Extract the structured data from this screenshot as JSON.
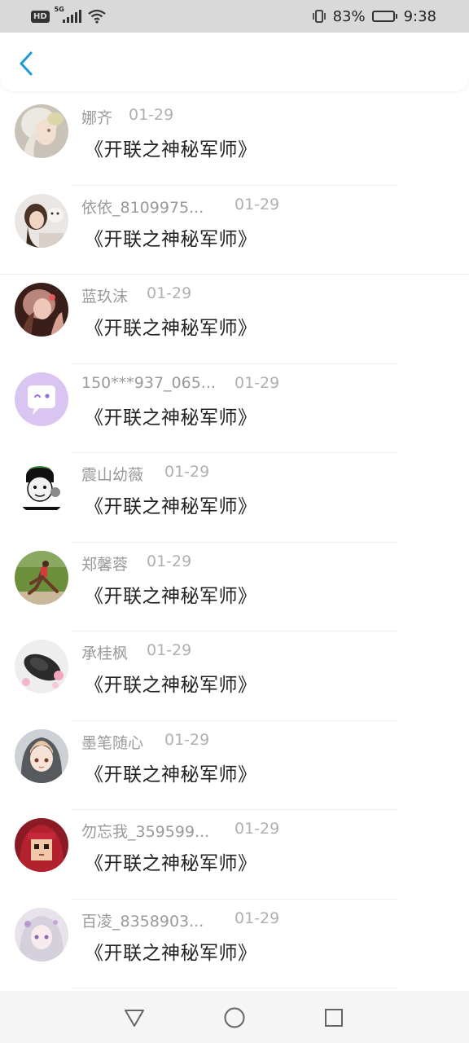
{
  "status_bar": {
    "hd": "HD",
    "network": "5G",
    "battery_percent": "83%",
    "battery_level": 0.83,
    "time": "9:38"
  },
  "header": {
    "back_icon": "chevron-left-icon",
    "accent": "#1a9ad6"
  },
  "items": [
    {
      "name": "娜齐",
      "date": "01-29",
      "title": "《开联之神秘军师》",
      "avatar": "anime-girl-white-hair"
    },
    {
      "name": "依依_8109975...",
      "date": "01-29",
      "title": "《开联之神秘军师》",
      "avatar": "girl-with-dog"
    },
    {
      "name": "蓝玖沫",
      "date": "01-29",
      "title": "《开联之神秘军师》",
      "avatar": "girl-photo"
    },
    {
      "name": "150***937_065...",
      "date": "01-29",
      "title": "《开联之神秘军师》",
      "avatar": "default-chat-avatar"
    },
    {
      "name": "震山幼薇",
      "date": "01-29",
      "title": "《开联之神秘军师》",
      "avatar": "meme-face"
    },
    {
      "name": "郑馨蓉",
      "date": "01-29",
      "title": "《开联之神秘军师》",
      "avatar": "runner-photo"
    },
    {
      "name": "承桂枫",
      "date": "01-29",
      "title": "《开联之神秘军师》",
      "avatar": "hat-flowers"
    },
    {
      "name": "墨笔随心",
      "date": "01-29",
      "title": "《开联之神秘军师》",
      "avatar": "anime-girl-hood"
    },
    {
      "name": "勿忘我_359599...",
      "date": "01-29",
      "title": "《开联之神秘军师》",
      "avatar": "pixel-red-hair"
    },
    {
      "name": "百凌_8358903...",
      "date": "01-29",
      "title": "《开联之神秘军师》",
      "avatar": "anime-girl-silver"
    }
  ],
  "nav_bar": {
    "back": "triangle-back-icon",
    "home": "circle-home-icon",
    "recents": "square-recents-icon"
  }
}
